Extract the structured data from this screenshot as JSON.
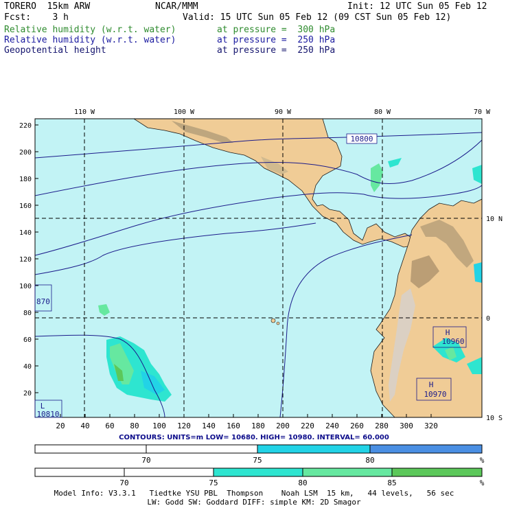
{
  "header": {
    "model": "TORERO  15km ARW",
    "center": "NCAR/MMM",
    "init": "Init: 12 UTC Sun 05 Feb 12",
    "fcst": "Fcst:    3 h",
    "valid": "Valid: 15 UTC Sun 05 Feb 12 (09 CST Sun 05 Feb 12)",
    "fields": [
      {
        "name": "Relative humidity (w.r.t. water)",
        "level": "at pressure =  300 hPa",
        "color": "#2e8b2e"
      },
      {
        "name": "Relative humidity (w.r.t. water)",
        "level": "at pressure =  250 hPa",
        "color": "#1a1aa0"
      },
      {
        "name": "Geopotential height",
        "level": "at pressure =  250 hPa",
        "color": "#14146e"
      }
    ]
  },
  "map": {
    "lon_labels": [
      "110 W",
      "100 W",
      "90 W",
      "80 W",
      "70 W"
    ],
    "lat_labels": [
      "10 N",
      "0",
      "10 S"
    ],
    "y_ticks": [
      "220",
      "200",
      "180",
      "160",
      "140",
      "120",
      "100",
      "80",
      "60",
      "40",
      "20"
    ],
    "x_ticks": [
      "20",
      "40",
      "60",
      "80",
      "100",
      "120",
      "140",
      "160",
      "180",
      "200",
      "220",
      "240",
      "260",
      "280",
      "300",
      "320"
    ],
    "contour_labels": [
      "10800",
      "870",
      "10810"
    ],
    "centers": [
      {
        "letter": "H",
        "value": "10960"
      },
      {
        "letter": "H",
        "value": "10970"
      },
      {
        "letter": "L",
        "value": "10810"
      }
    ]
  },
  "contours_line": "CONTOURS:  UNITS=m  LOW=  10680.     HIGH=  10980.     INTERVAL=   60.000",
  "colorbar_1": {
    "ticks": [
      "70",
      "75",
      "80",
      "%"
    ],
    "colors": [
      "#ffffff",
      "#ffffff",
      "#22d3e6",
      "#4a8fe3"
    ]
  },
  "colorbar_2": {
    "ticks": [
      "70",
      "75",
      "80",
      "85",
      "%"
    ],
    "colors": [
      "#ffffff",
      "#ffffff",
      "#2ee5d0",
      "#66e8a0",
      "#5cc85a"
    ]
  },
  "model_info": {
    "line1": "Model Info: V3.3.1   Tiedtke YSU PBL  Thompson    Noah LSM  15 km,   44 levels,   56 sec",
    "line2": "LW: Godd SW: Goddard DIFF: simple KM: 2D Smagor"
  }
}
